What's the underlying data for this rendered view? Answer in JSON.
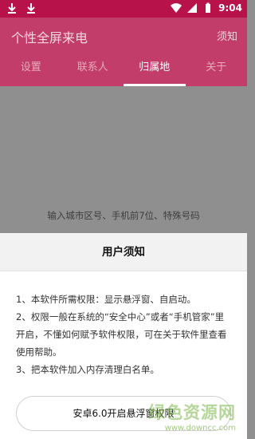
{
  "status_bar": {
    "time": "9:04"
  },
  "app_bar": {
    "title": "个性全屏来电",
    "action": "须知"
  },
  "tabs": [
    {
      "label": "设置"
    },
    {
      "label": "联系人"
    },
    {
      "label": "归属地"
    },
    {
      "label": "关于"
    }
  ],
  "content": {
    "hint": "输入城市区号、手机前7位、特殊号码"
  },
  "dialog": {
    "title": "用户须知",
    "items": [
      "1、本软件所需权限：显示悬浮窗、自启动。",
      "2、权限一般在系统的“安全中心”或者“手机管家”里开启，不懂如何赋予软件权限，可在关于软件里查看使用帮助。",
      "3、把本软件加入内存清理白名单。"
    ],
    "button": "安卓6.0开启悬浮窗权限"
  },
  "watermark": {
    "main": "绿色资源网",
    "sub": "www.downcc.com"
  },
  "colors": {
    "primary": "#c23d6a",
    "status_bar": "#b8124a",
    "overlay": "#8f8f8f"
  }
}
